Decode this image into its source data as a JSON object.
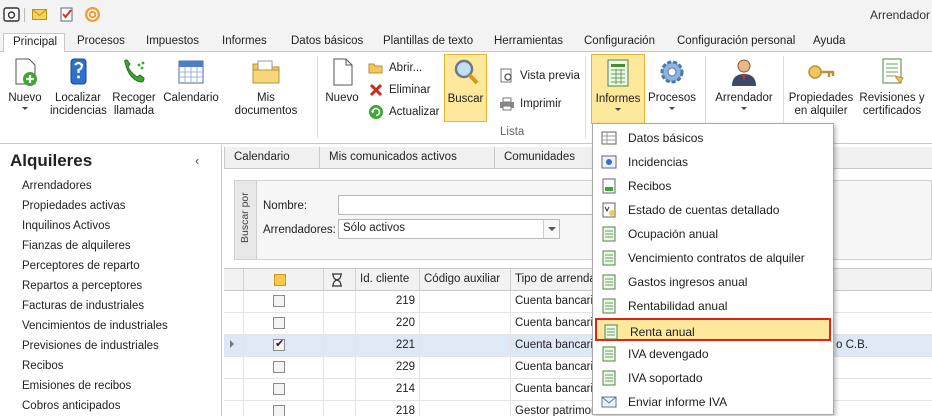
{
  "window": {
    "title": "Arrendador"
  },
  "ribbon_tabs": [
    "Principal",
    "Procesos",
    "Impuestos",
    "Informes",
    "Datos básicos",
    "Plantillas de texto",
    "Herramientas",
    "Configuración",
    "Configuración personal",
    "Ayuda"
  ],
  "ribbon": {
    "nuevo": "Nuevo",
    "localizar": [
      "Localizar",
      "incidencias"
    ],
    "recoger": [
      "Recoger",
      "llamada"
    ],
    "calendario": "Calendario",
    "mis_documentos": "Mis documentos",
    "nuevo2": "Nuevo",
    "abrir": "Abrir...",
    "eliminar": "Eliminar",
    "actualizar": "Actualizar",
    "buscar": "Buscar",
    "vista_previa": "Vista previa",
    "imprimir": "Imprimir",
    "group_lista": "Lista",
    "informes": "Informes",
    "procesos": "Procesos",
    "arrendador": "Arrendador",
    "propiedades": [
      "Propiedades",
      "en alquiler"
    ],
    "revisiones": [
      "Revisiones y",
      "certificados"
    ]
  },
  "leftnav": {
    "title": "Alquileres",
    "items": [
      "Arrendadores",
      "Propiedades activas",
      "Inquilinos Activos",
      "Fianzas de alquileres",
      "Perceptores de reparto",
      "Repartos a perceptores",
      "Facturas de industriales",
      "Vencimientos de industriales",
      "Previsiones de industriales",
      "Recibos",
      "Emisiones de recibos",
      "Cobros anticipados"
    ]
  },
  "doc_tabs": [
    "Calendario",
    "Mis comunicados activos",
    "Comunidades"
  ],
  "search": {
    "panel_label": "Buscar por",
    "nombre_label": "Nombre:",
    "nombre_value": "",
    "arrendadores_label": "Arrendadores:",
    "arrendadores_value": "Sólo activos"
  },
  "grid": {
    "columns": [
      "Id. cliente",
      "Código auxiliar",
      "Tipo de arrendador"
    ],
    "rows": [
      {
        "id": "219",
        "codigo": "",
        "tipo": "Cuenta bancaria",
        "checked": false,
        "selected": false
      },
      {
        "id": "220",
        "codigo": "",
        "tipo": "Cuenta bancaria",
        "checked": false,
        "selected": false
      },
      {
        "id": "221",
        "codigo": "",
        "tipo": "Cuenta bancaria",
        "checked": true,
        "selected": true
      },
      {
        "id": "229",
        "codigo": "",
        "tipo": "Cuenta bancaria",
        "checked": false,
        "selected": false
      },
      {
        "id": "214",
        "codigo": "",
        "tipo": "Cuenta bancaria",
        "checked": false,
        "selected": false
      },
      {
        "id": "218",
        "codigo": "",
        "tipo": "Gestor patrimonial",
        "checked": false,
        "selected": false
      }
    ],
    "selected_row_tail": "o C.B."
  },
  "menu": {
    "items": [
      "Datos básicos",
      "Incidencias",
      "Recibos",
      "Estado de cuentas detallado",
      "Ocupación anual",
      "Vencimiento contratos de alquiler",
      "Gastos ingresos anual",
      "Rentabilidad anual",
      "Renta anual",
      "IVA devengado",
      "IVA soportado",
      "Enviar informe IVA"
    ],
    "highlighted": "Renta anual"
  },
  "colors": {
    "accent_yellow": "#fde89b",
    "highlight_red": "#d9251d",
    "selection_blue": "#dfe8f6"
  }
}
